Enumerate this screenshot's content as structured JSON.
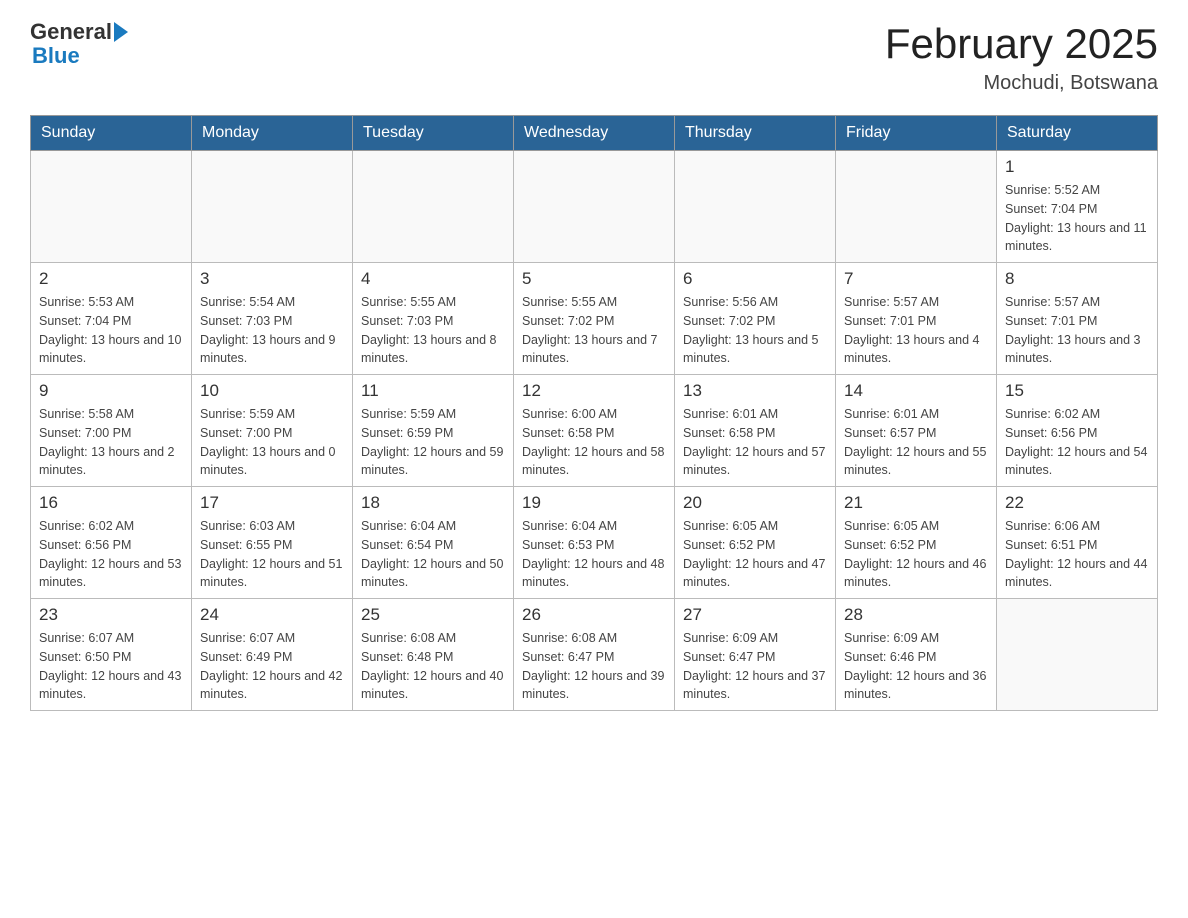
{
  "header": {
    "logo_text_general": "General",
    "logo_text_blue": "Blue",
    "month_title": "February 2025",
    "location": "Mochudi, Botswana"
  },
  "weekdays": [
    "Sunday",
    "Monday",
    "Tuesday",
    "Wednesday",
    "Thursday",
    "Friday",
    "Saturday"
  ],
  "weeks": [
    [
      {
        "day": "",
        "sunrise": "",
        "sunset": "",
        "daylight": ""
      },
      {
        "day": "",
        "sunrise": "",
        "sunset": "",
        "daylight": ""
      },
      {
        "day": "",
        "sunrise": "",
        "sunset": "",
        "daylight": ""
      },
      {
        "day": "",
        "sunrise": "",
        "sunset": "",
        "daylight": ""
      },
      {
        "day": "",
        "sunrise": "",
        "sunset": "",
        "daylight": ""
      },
      {
        "day": "",
        "sunrise": "",
        "sunset": "",
        "daylight": ""
      },
      {
        "day": "1",
        "sunrise": "Sunrise: 5:52 AM",
        "sunset": "Sunset: 7:04 PM",
        "daylight": "Daylight: 13 hours and 11 minutes."
      }
    ],
    [
      {
        "day": "2",
        "sunrise": "Sunrise: 5:53 AM",
        "sunset": "Sunset: 7:04 PM",
        "daylight": "Daylight: 13 hours and 10 minutes."
      },
      {
        "day": "3",
        "sunrise": "Sunrise: 5:54 AM",
        "sunset": "Sunset: 7:03 PM",
        "daylight": "Daylight: 13 hours and 9 minutes."
      },
      {
        "day": "4",
        "sunrise": "Sunrise: 5:55 AM",
        "sunset": "Sunset: 7:03 PM",
        "daylight": "Daylight: 13 hours and 8 minutes."
      },
      {
        "day": "5",
        "sunrise": "Sunrise: 5:55 AM",
        "sunset": "Sunset: 7:02 PM",
        "daylight": "Daylight: 13 hours and 7 minutes."
      },
      {
        "day": "6",
        "sunrise": "Sunrise: 5:56 AM",
        "sunset": "Sunset: 7:02 PM",
        "daylight": "Daylight: 13 hours and 5 minutes."
      },
      {
        "day": "7",
        "sunrise": "Sunrise: 5:57 AM",
        "sunset": "Sunset: 7:01 PM",
        "daylight": "Daylight: 13 hours and 4 minutes."
      },
      {
        "day": "8",
        "sunrise": "Sunrise: 5:57 AM",
        "sunset": "Sunset: 7:01 PM",
        "daylight": "Daylight: 13 hours and 3 minutes."
      }
    ],
    [
      {
        "day": "9",
        "sunrise": "Sunrise: 5:58 AM",
        "sunset": "Sunset: 7:00 PM",
        "daylight": "Daylight: 13 hours and 2 minutes."
      },
      {
        "day": "10",
        "sunrise": "Sunrise: 5:59 AM",
        "sunset": "Sunset: 7:00 PM",
        "daylight": "Daylight: 13 hours and 0 minutes."
      },
      {
        "day": "11",
        "sunrise": "Sunrise: 5:59 AM",
        "sunset": "Sunset: 6:59 PM",
        "daylight": "Daylight: 12 hours and 59 minutes."
      },
      {
        "day": "12",
        "sunrise": "Sunrise: 6:00 AM",
        "sunset": "Sunset: 6:58 PM",
        "daylight": "Daylight: 12 hours and 58 minutes."
      },
      {
        "day": "13",
        "sunrise": "Sunrise: 6:01 AM",
        "sunset": "Sunset: 6:58 PM",
        "daylight": "Daylight: 12 hours and 57 minutes."
      },
      {
        "day": "14",
        "sunrise": "Sunrise: 6:01 AM",
        "sunset": "Sunset: 6:57 PM",
        "daylight": "Daylight: 12 hours and 55 minutes."
      },
      {
        "day": "15",
        "sunrise": "Sunrise: 6:02 AM",
        "sunset": "Sunset: 6:56 PM",
        "daylight": "Daylight: 12 hours and 54 minutes."
      }
    ],
    [
      {
        "day": "16",
        "sunrise": "Sunrise: 6:02 AM",
        "sunset": "Sunset: 6:56 PM",
        "daylight": "Daylight: 12 hours and 53 minutes."
      },
      {
        "day": "17",
        "sunrise": "Sunrise: 6:03 AM",
        "sunset": "Sunset: 6:55 PM",
        "daylight": "Daylight: 12 hours and 51 minutes."
      },
      {
        "day": "18",
        "sunrise": "Sunrise: 6:04 AM",
        "sunset": "Sunset: 6:54 PM",
        "daylight": "Daylight: 12 hours and 50 minutes."
      },
      {
        "day": "19",
        "sunrise": "Sunrise: 6:04 AM",
        "sunset": "Sunset: 6:53 PM",
        "daylight": "Daylight: 12 hours and 48 minutes."
      },
      {
        "day": "20",
        "sunrise": "Sunrise: 6:05 AM",
        "sunset": "Sunset: 6:52 PM",
        "daylight": "Daylight: 12 hours and 47 minutes."
      },
      {
        "day": "21",
        "sunrise": "Sunrise: 6:05 AM",
        "sunset": "Sunset: 6:52 PM",
        "daylight": "Daylight: 12 hours and 46 minutes."
      },
      {
        "day": "22",
        "sunrise": "Sunrise: 6:06 AM",
        "sunset": "Sunset: 6:51 PM",
        "daylight": "Daylight: 12 hours and 44 minutes."
      }
    ],
    [
      {
        "day": "23",
        "sunrise": "Sunrise: 6:07 AM",
        "sunset": "Sunset: 6:50 PM",
        "daylight": "Daylight: 12 hours and 43 minutes."
      },
      {
        "day": "24",
        "sunrise": "Sunrise: 6:07 AM",
        "sunset": "Sunset: 6:49 PM",
        "daylight": "Daylight: 12 hours and 42 minutes."
      },
      {
        "day": "25",
        "sunrise": "Sunrise: 6:08 AM",
        "sunset": "Sunset: 6:48 PM",
        "daylight": "Daylight: 12 hours and 40 minutes."
      },
      {
        "day": "26",
        "sunrise": "Sunrise: 6:08 AM",
        "sunset": "Sunset: 6:47 PM",
        "daylight": "Daylight: 12 hours and 39 minutes."
      },
      {
        "day": "27",
        "sunrise": "Sunrise: 6:09 AM",
        "sunset": "Sunset: 6:47 PM",
        "daylight": "Daylight: 12 hours and 37 minutes."
      },
      {
        "day": "28",
        "sunrise": "Sunrise: 6:09 AM",
        "sunset": "Sunset: 6:46 PM",
        "daylight": "Daylight: 12 hours and 36 minutes."
      },
      {
        "day": "",
        "sunrise": "",
        "sunset": "",
        "daylight": ""
      }
    ]
  ]
}
